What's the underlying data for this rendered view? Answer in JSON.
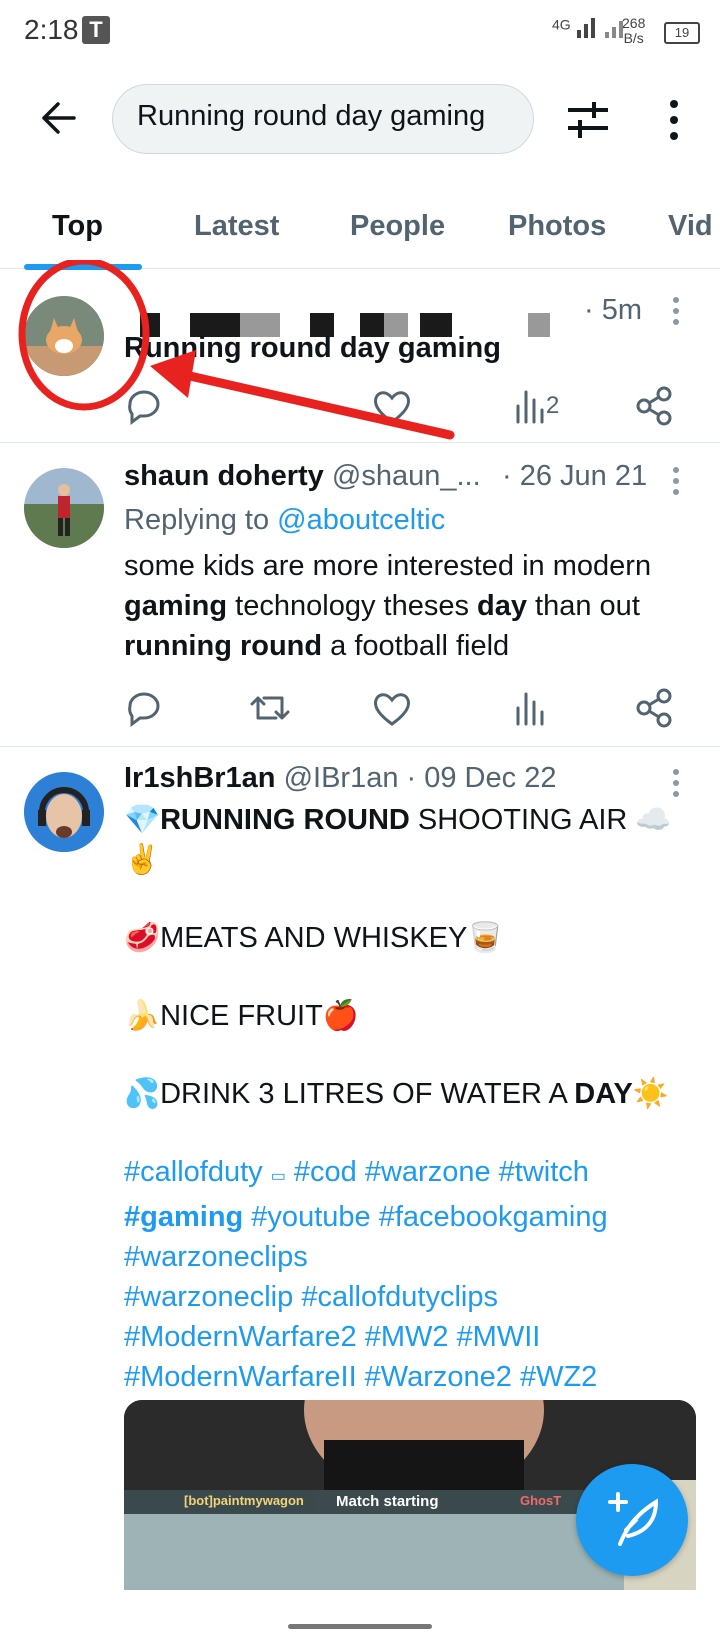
{
  "status_bar": {
    "time": "2:18",
    "app_badge": "T",
    "network": "4G",
    "speed_value": "268",
    "speed_unit": "B/s",
    "battery": "19"
  },
  "search": {
    "query": "Running round day gaming"
  },
  "tabs": [
    "Top",
    "Latest",
    "People",
    "Photos",
    "Vid"
  ],
  "tweets": [
    {
      "time": "· 5m",
      "text": "Running round day gaming",
      "views": "2"
    },
    {
      "name": "shaun doherty",
      "handle": "@shaun_...",
      "time": "· 26 Jun 21",
      "reply_prefix": "Replying to ",
      "reply_to": "@aboutceltic",
      "text_parts": [
        "some kids are more interested in modern ",
        "gaming",
        " technology theses ",
        "day",
        " than out ",
        "running round",
        " a football field"
      ]
    },
    {
      "name": "Ir1shBr1an",
      "handle": "@IBr1an",
      "time": "· 09 Dec 22",
      "line1_bold": "RUNNING ROUND",
      "line1_rest": " SHOOTING AIR",
      "line2": "MEATS AND WHISKEY",
      "line3": "NICE FRUIT",
      "line4_pre": "DRINK 3 LITRES OF WATER A ",
      "line4_bold": "DAY",
      "hashtags1": "#callofduty",
      "hashtags1b": "#cod #warzone #twitch",
      "hashtag_gaming": "#gaming",
      "hashtags2": " #youtube #facebookgaming",
      "hashtags3": "#warzoneclips",
      "hashtags4": "#warzoneclip #callofdutyclips",
      "hashtags5": "#ModernWarfare2 #MW2 #MWII",
      "hashtags6": "#ModernWarfareII #Warzone2 #WZ2",
      "media_label": "Match starting",
      "media_left": "[bot]paintmywagon",
      "media_right": "GhosT"
    }
  ],
  "colors": {
    "accent": "#1d9bf0",
    "text": "#0f1419",
    "muted": "#536471",
    "annotation": "#e8231f"
  },
  "icons": [
    "back-arrow-icon",
    "filter-icon",
    "more-vertical-icon",
    "reply-icon",
    "retweet-icon",
    "like-icon",
    "views-icon",
    "share-icon",
    "compose-icon"
  ]
}
